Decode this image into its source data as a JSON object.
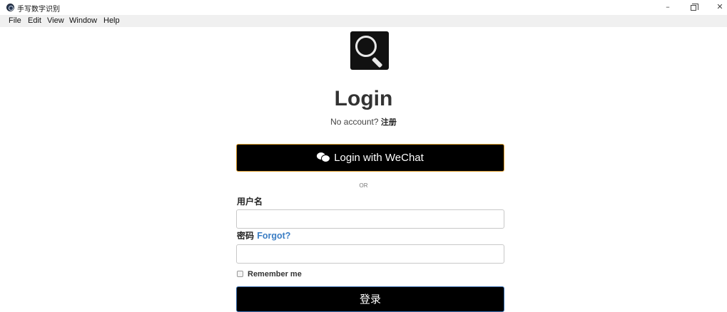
{
  "window": {
    "title": "手写数字识别",
    "controls": {
      "minimize": "–",
      "close": "✕"
    }
  },
  "menubar": {
    "items": [
      "File",
      "Edit",
      "View",
      "Window",
      "Help"
    ]
  },
  "login": {
    "logo_icon": "magnifier-icon",
    "title": "Login",
    "no_account_text": "No account?",
    "register_link": "注册",
    "wechat_button": "Login with WeChat",
    "wechat_icon": "wechat-icon",
    "or_text": "OR",
    "username_label": "用户名",
    "username_value": "",
    "password_label": "密码",
    "forgot_link": "Forgot?",
    "password_value": "",
    "remember_label": "Remember me",
    "remember_checked": false,
    "submit_button": "登录"
  },
  "colors": {
    "button_bg": "#000000",
    "wechat_border": "#e0a030",
    "submit_border": "#3a6fb0",
    "link": "#3a7dc4",
    "menubar_bg": "#f0f0f0"
  }
}
